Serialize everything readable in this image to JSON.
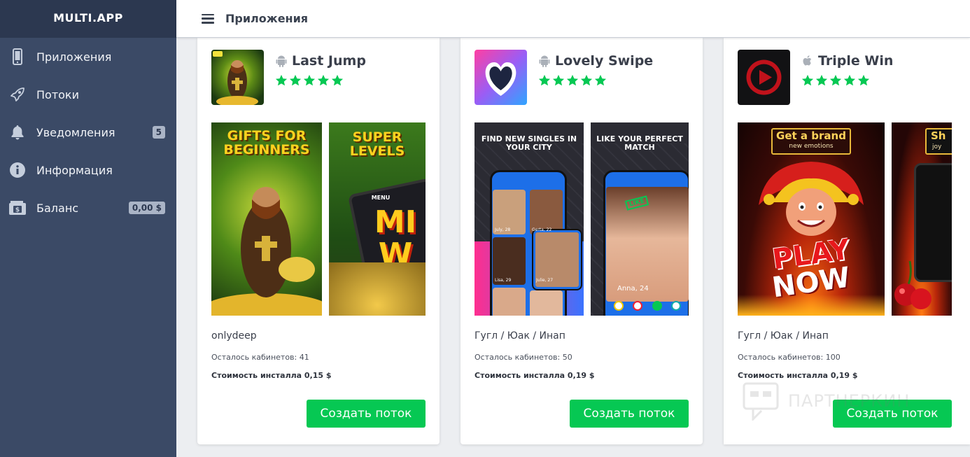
{
  "app": {
    "logo": "MULTI.APP"
  },
  "header": {
    "title": "Приложения"
  },
  "sidebar": {
    "items": [
      {
        "label": "Приложения",
        "icon": "phone-icon",
        "badge": ""
      },
      {
        "label": "Потоки",
        "icon": "rocket-icon",
        "badge": ""
      },
      {
        "label": "Уведомления",
        "icon": "bell-icon",
        "badge": "5"
      },
      {
        "label": "Информация",
        "icon": "info-icon",
        "badge": ""
      },
      {
        "label": "Баланс",
        "icon": "wallet-icon",
        "badge": "0,00 $"
      }
    ]
  },
  "cards": [
    {
      "name": "Last Jump",
      "platform": "android",
      "rating": 5,
      "shot1": "GIFTS FOR BEGINNERS",
      "shot2": "SUPER LEVELS",
      "shot2_extra": "MENU",
      "shot2_big": "MI W",
      "publisher": "onlydeep",
      "cabinets": "Осталось кабинетов: 41",
      "price": "Стоимость инсталла 0,15 $",
      "button": "Создать поток"
    },
    {
      "name": "Lovely Swipe",
      "platform": "android",
      "rating": 5,
      "shot1": "FIND NEW SINGLES IN YOUR CITY",
      "shot2": "LIKE YOUR PERFECT MATCH",
      "shot1_profiles": [
        "July, 28",
        "Gerta, 22",
        "Lisa, 29",
        "Julie, 27"
      ],
      "shot2_like": "LIKE",
      "shot2_profile": "Anna, 24",
      "publisher": "Гугл / Юак / Инап",
      "cabinets": "Осталось кабинетов: 50",
      "price": "Стоимость инсталла 0,19 $",
      "button": "Создать поток"
    },
    {
      "name": "Triple Win",
      "platform": "ios",
      "rating": 5,
      "shot1_title": "Get a brand",
      "shot1_sub": "new emotions",
      "shot1_play": "PLAY",
      "shot1_now": "NOW",
      "shot2_title": "Sh",
      "shot2_sub": "joy",
      "publisher": "Гугл / Юак / Инап",
      "cabinets": "Осталось кабинетов: 100",
      "price": "Стоимость инсталла 0,19 $",
      "button": "Создать поток"
    }
  ],
  "watermark": "ПАРТНЕРКИН",
  "colors": {
    "sidebar": "#3b4a66",
    "accent": "#06c853",
    "star": "#06c853"
  }
}
